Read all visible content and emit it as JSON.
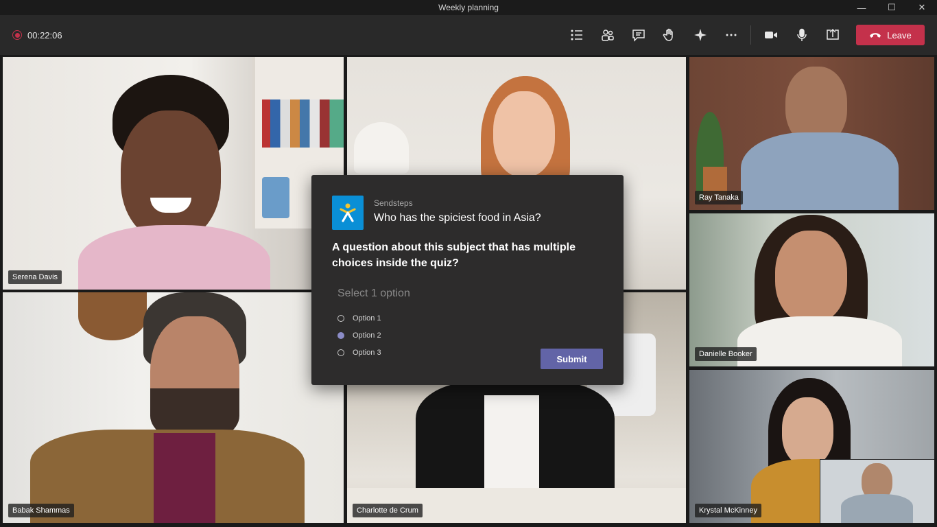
{
  "window": {
    "title": "Weekly planning",
    "controls": [
      "—",
      "☐",
      "✕"
    ]
  },
  "recording": {
    "time": "00:22:06"
  },
  "toolbar": {
    "leave_label": "Leave",
    "icons": [
      "participants-list-icon",
      "people-icon",
      "chat-icon",
      "raise-hand-icon",
      "apps-icon",
      "more-icon",
      "camera-icon",
      "mic-icon",
      "share-icon"
    ]
  },
  "participants": [
    {
      "name": "Serena Davis"
    },
    {
      "name": "Charlotte de Crum"
    },
    {
      "name": "Ray Tanaka"
    },
    {
      "name": "Danielle Booker"
    },
    {
      "name": "Babak Shammas"
    },
    {
      "name": "Krystal McKinney"
    }
  ],
  "quiz": {
    "app_name": "Sendsteps",
    "title": "Who has the spiciest food in Asia?",
    "question": "A question about this subject that has multiple choices inside the quiz?",
    "select_label": "Select 1 option",
    "options": [
      "Option 1",
      "Option 2",
      "Option 3"
    ],
    "selected_index": 1,
    "submit_label": "Submit"
  },
  "colors": {
    "leave": "#c4314b",
    "submit": "#6264a7",
    "app_logo": "#0a8fd6",
    "selected_radio": "#8b8cc7"
  }
}
